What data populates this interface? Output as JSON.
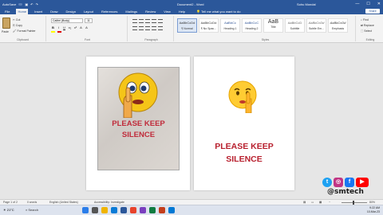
{
  "titlebar": {
    "autosave": "AutoSave",
    "doc_title": "Document2 - Word",
    "search_placeholder": "Tell me what you want to do",
    "user": "Sohu Mondal",
    "controls": [
      "—",
      "☐",
      "✕"
    ]
  },
  "tabs": [
    "File",
    "Home",
    "Insert",
    "Draw",
    "Design",
    "Layout",
    "References",
    "Mailings",
    "Review",
    "View",
    "Help"
  ],
  "active_tab": "Home",
  "tell_me": "Tell me what you want to do",
  "share_label": "Share",
  "clipboard": {
    "paste": "Paste",
    "items": [
      "Cut",
      "Copy",
      "Format Painter"
    ],
    "label": "Clipboard"
  },
  "font": {
    "name": "Calibri (Body)",
    "size": "11",
    "buttons": [
      "B",
      "I",
      "U",
      "x₂",
      "x²",
      "A",
      "A"
    ],
    "label": "Font"
  },
  "paragraph": {
    "label": "Paragraph"
  },
  "styles": {
    "tiles": [
      {
        "preview": "AaBbCcDd",
        "name": "¶ Normal"
      },
      {
        "preview": "AaBbCcDd",
        "name": "¶ No Spac..."
      },
      {
        "preview": "AaBbCc",
        "name": "Heading 1"
      },
      {
        "preview": "AaBbCcC",
        "name": "Heading 2"
      },
      {
        "preview": "AaB",
        "name": "Title"
      },
      {
        "preview": "AaBbCcD",
        "name": "Subtitle"
      },
      {
        "preview": "AaBbCcDd",
        "name": "Subtle Em..."
      },
      {
        "preview": "AaBbCcDd",
        "name": "Emphasis"
      }
    ],
    "label": "Styles"
  },
  "editing": {
    "items": [
      "Find",
      "Replace",
      "Select"
    ],
    "label": "Editing"
  },
  "pages": {
    "left_sign": [
      "PLEASE KEEP",
      "SILENCE"
    ],
    "right_sign": [
      "PLEASE KEEP",
      "SILENCE"
    ]
  },
  "watermark": {
    "text": "@smtech",
    "icons": [
      "twitter-icon",
      "instagram-icon",
      "facebook-icon",
      "youtube-icon"
    ]
  },
  "statusbar": {
    "page": "Page 1 of 2",
    "words": "0 words",
    "language": "English (United States)",
    "accessibility": "Accessibility: Investigate",
    "zoom": "80%"
  },
  "taskbar": {
    "weather": "21°C",
    "search": "Search",
    "time": "9:22 AM",
    "date": "10-Mar-23"
  },
  "colors": {
    "word_blue": "#2b579a",
    "sign_red": "#c02b3a"
  }
}
